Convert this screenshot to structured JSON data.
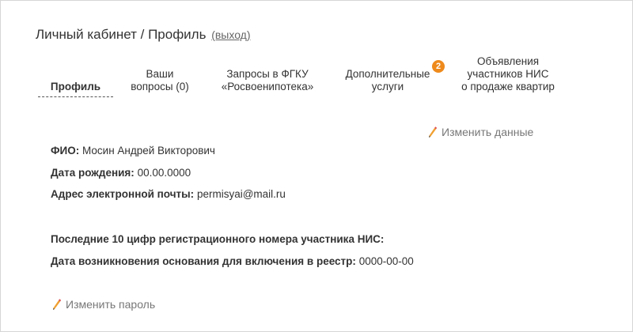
{
  "header": {
    "title": "Личный кабинет / Профиль",
    "logout": "(выход)"
  },
  "tabs": [
    {
      "line1": "Профиль",
      "line2": "",
      "line3": ""
    },
    {
      "line1": "Ваши",
      "line2": "вопросы (0)",
      "line3": ""
    },
    {
      "line1": "Запросы в ФГКУ",
      "line2": "«Росвоенипотека»",
      "line3": ""
    },
    {
      "line1": "Дополнительные",
      "line2": "услуги",
      "line3": "",
      "badge": "2"
    },
    {
      "line1": "Объявления",
      "line2": "участников НИС",
      "line3": "о продаже квартир"
    }
  ],
  "actions": {
    "edit_data": "Изменить данные",
    "change_password": "Изменить пароль"
  },
  "profile": {
    "fio_label": "ФИО:",
    "fio_value": "Мосин Андрей Викторович",
    "birth_label": "Дата рождения:",
    "birth_value": "00.00.0000",
    "email_label": "Адрес электронной почты:",
    "email_value": "permisyai@mail.ru",
    "reg_label": "Последние 10 цифр регистрационного номера участника НИС:",
    "reg_value": "",
    "date_label": "Дата возникновения основания для включения в реестр:",
    "date_value": "0000-00-00"
  },
  "colors": {
    "accent": "#ee8a1c",
    "text": "#333333",
    "muted": "#777777",
    "border": "#d6d6d6"
  }
}
